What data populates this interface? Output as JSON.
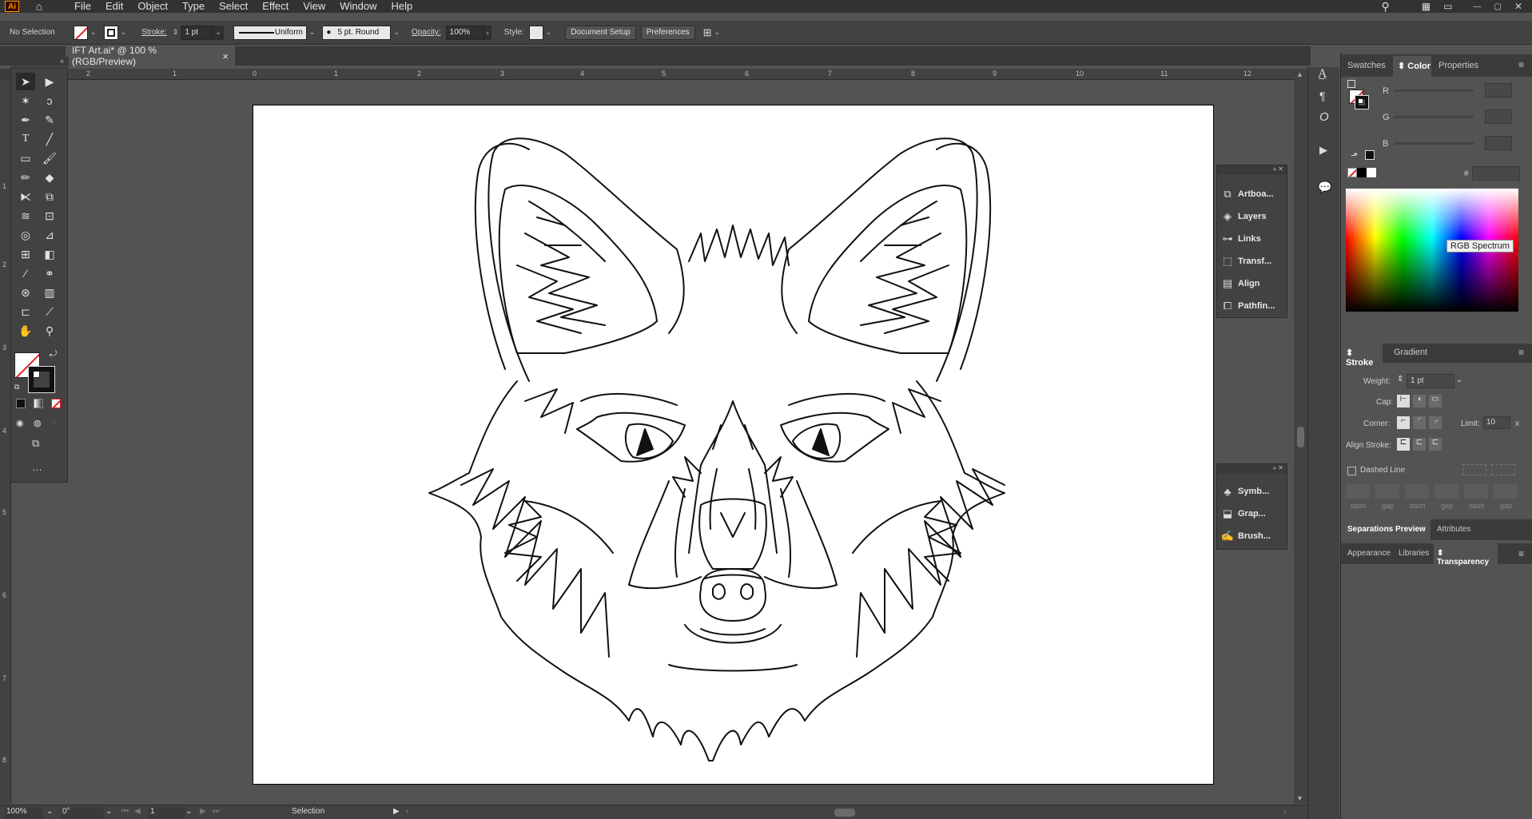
{
  "menubar": {
    "logo": "Ai",
    "items": [
      "File",
      "Edit",
      "Object",
      "Type",
      "Select",
      "Effect",
      "View",
      "Window",
      "Help"
    ]
  },
  "control_bar": {
    "selection": "No Selection",
    "stroke_label": "Stroke:",
    "stroke_value": "1 pt",
    "profile": "Uniform",
    "brush": "5 pt. Round",
    "opacity_label": "Opacity:",
    "opacity_value": "100%",
    "style_label": "Style:",
    "document_setup": "Document Setup",
    "preferences": "Preferences"
  },
  "document_tab": {
    "title": "IFT Art.ai* @ 100 % (RGB/Preview)",
    "close": "×"
  },
  "ruler_h": [
    "2",
    "1",
    "0",
    "1",
    "2",
    "3",
    "4",
    "5",
    "6",
    "7",
    "8",
    "9",
    "10",
    "11",
    "12"
  ],
  "ruler_v": [
    "1",
    "2",
    "3",
    "4",
    "5",
    "6",
    "7",
    "8"
  ],
  "floating_panel_1": {
    "items": [
      "Artboa...",
      "Layers",
      "Links",
      "Transf...",
      "Align",
      "Pathfin..."
    ]
  },
  "floating_panel_2": {
    "items": [
      "Symb...",
      "Grap...",
      "Brush..."
    ]
  },
  "color_panel": {
    "tabs": [
      "Swatches",
      "Color",
      "Properties"
    ],
    "active_tab": "Color",
    "channels": [
      "R",
      "G",
      "B"
    ],
    "hex_label": "#",
    "tooltip": "RGB Spectrum"
  },
  "stroke_panel": {
    "tabs": [
      "Stroke",
      "Gradient"
    ],
    "weight_label": "Weight:",
    "weight_value": "1 pt",
    "cap_label": "Cap:",
    "corner_label": "Corner:",
    "limit_label": "Limit:",
    "limit_value": "10",
    "limit_unit": "x",
    "align_label": "Align Stroke:",
    "dashed_label": "Dashed Line",
    "dash_labels": [
      "dash",
      "gap",
      "dash",
      "gap",
      "dash",
      "gap"
    ]
  },
  "tabs_sep": [
    "Separations Preview",
    "Attributes"
  ],
  "tabs_bottom": [
    "Appearance",
    "Libraries",
    "Transparency"
  ],
  "status_bar": {
    "zoom": "100%",
    "rotation": "0°",
    "artboard": "1",
    "tool": "Selection"
  },
  "colors": {
    "bg": "#535353",
    "panel": "#424242",
    "menubar": "#323232",
    "accent_red": "#e0202a"
  }
}
